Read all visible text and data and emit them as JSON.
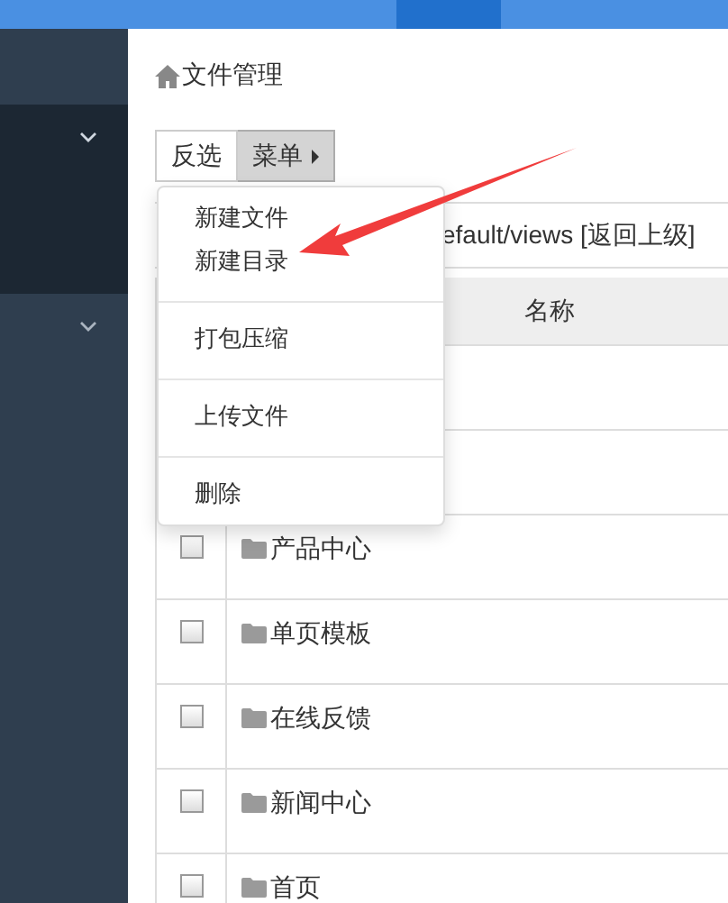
{
  "sidebar": {
    "items": [
      {
        "selected": true
      },
      {
        "selected": false
      }
    ]
  },
  "breadcrumb": "文件管理",
  "toolbar": {
    "buttons": [
      {
        "label": "反选",
        "kind": "plain"
      },
      {
        "label": "菜单",
        "kind": "dropdown",
        "selected": true
      }
    ]
  },
  "menu": {
    "groups": [
      [
        "新建文件",
        "新建目录"
      ],
      [
        "打包压缩"
      ],
      [
        "上传文件"
      ],
      [
        "删除"
      ]
    ]
  },
  "path": {
    "text": "efault/views",
    "link": "[返回上级]"
  },
  "table": {
    "columns": [
      "名称"
    ],
    "rows": [
      {
        "kind": "covered"
      },
      {
        "kind": "covered"
      },
      {
        "kind": "folder",
        "name": "产品中心",
        "checked": false
      },
      {
        "kind": "folder",
        "name": "单页模板",
        "checked": false
      },
      {
        "kind": "folder",
        "name": "在线反馈",
        "checked": false
      },
      {
        "kind": "folder",
        "name": "新闻中心",
        "checked": false
      },
      {
        "kind": "folder",
        "name": "首页",
        "checked": false
      }
    ]
  }
}
